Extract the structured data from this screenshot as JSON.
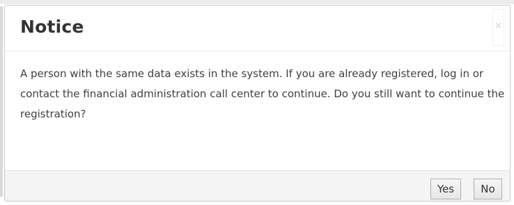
{
  "dialog": {
    "title": "Notice",
    "close_label": "×",
    "message": "A person with the same data exists in the system. If you are already registered, log in or contact the financial administration call center to continue. Do you still want to continue the registration?",
    "buttons": {
      "yes_label": "Yes",
      "no_label": "No"
    }
  },
  "colors": {
    "title_text": "#333333",
    "body_text": "#404040",
    "footer_background": "#f4f4f4",
    "button_border": "#adadad"
  }
}
